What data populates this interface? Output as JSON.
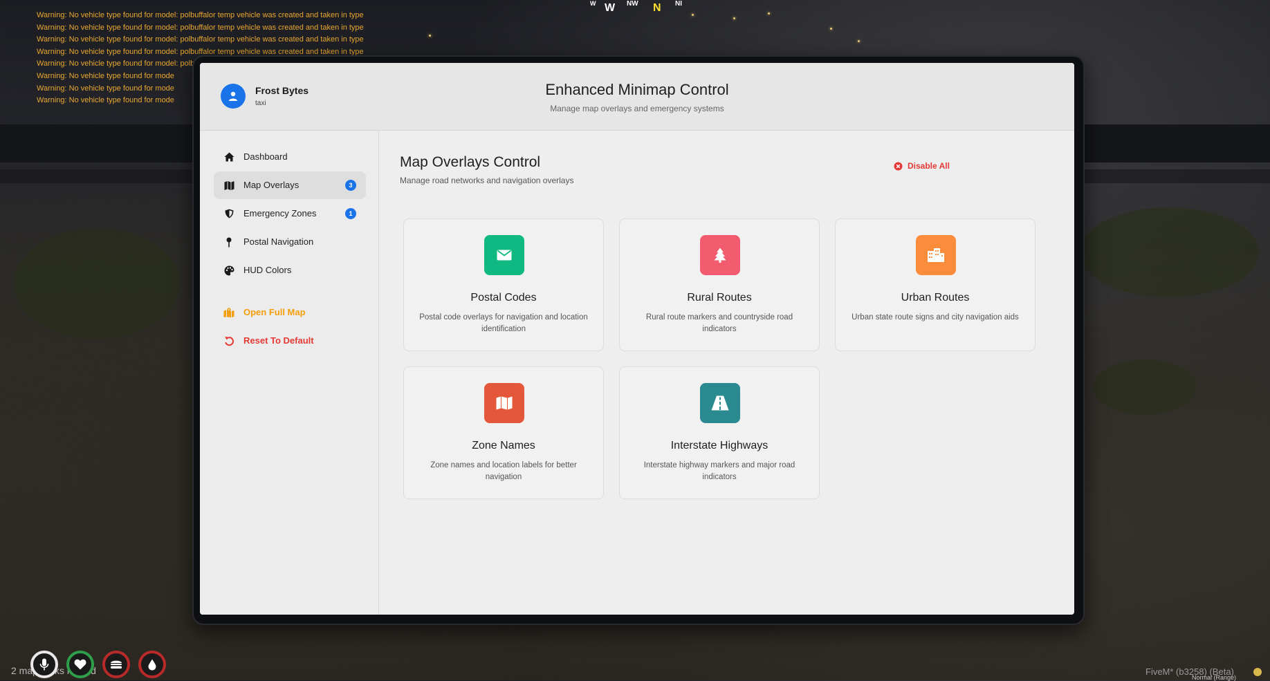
{
  "console": {
    "warnings": [
      "Warning: No vehicle type found for model: polbuffalor temp vehicle was created and taken in type",
      "Warning: No vehicle type found for model: polbuffalor temp vehicle was created and taken in type",
      "Warning: No vehicle type found for model: polbuffalor temp vehicle was created and taken in type",
      "Warning: No vehicle type found for model: polbuffalor temp vehicle was created and taken in type",
      "Warning: No vehicle type found for model: polbuffalor temp vehicle was created and taken in type",
      "Warning: No vehicle type found for mode",
      "Warning: No vehicle type found for mode",
      "Warning: No vehicle type found for mode"
    ]
  },
  "compass": {
    "w_small": "W",
    "w": "W",
    "nw": "NW",
    "n": "N",
    "ne": "NI"
  },
  "user": {
    "name": "Frost Bytes",
    "role": "taxi"
  },
  "app": {
    "title": "Enhanced Minimap Control",
    "subtitle": "Manage map overlays and emergency systems"
  },
  "sidebar": {
    "items": [
      {
        "label": "Dashboard",
        "icon": "home-icon"
      },
      {
        "label": "Map Overlays",
        "icon": "map-icon",
        "badge": "3",
        "active": true
      },
      {
        "label": "Emergency Zones",
        "icon": "shield-icon",
        "badge": "1"
      },
      {
        "label": "Postal Navigation",
        "icon": "map-pin-icon"
      },
      {
        "label": "HUD Colors",
        "icon": "palette-icon"
      }
    ],
    "actions": [
      {
        "label": "Open Full Map",
        "icon": "map-marked-icon",
        "color": "#f59e0b"
      },
      {
        "label": "Reset To Default",
        "icon": "undo-icon",
        "color": "#e53935"
      }
    ]
  },
  "main": {
    "title": "Map Overlays Control",
    "subtitle": "Manage road networks and navigation overlays",
    "disable_all": "Disable All",
    "cards": [
      {
        "title": "Postal Codes",
        "desc": "Postal code overlays for navigation and location identification",
        "icon": "envelope-icon",
        "color": "#10b981"
      },
      {
        "title": "Rural Routes",
        "desc": "Rural route markers and countryside road indicators",
        "icon": "tree-icon",
        "color": "#f25c6e"
      },
      {
        "title": "Urban Routes",
        "desc": "Urban state route signs and city navigation aids",
        "icon": "city-icon",
        "color": "#fb8c3c"
      },
      {
        "title": "Zone Names",
        "desc": "Zone names and location labels for better navigation",
        "icon": "map-icon",
        "color": "#e5573a"
      },
      {
        "title": "Interstate Highways",
        "desc": "Interstate highway markers and major road indicators",
        "icon": "road-icon",
        "color": "#2b8a8f"
      }
    ]
  },
  "footer": {
    "loaded_text": "2 map parks loaded",
    "version": "FiveM* (b3258) (Beta)",
    "mode": "Normal (Range)"
  }
}
